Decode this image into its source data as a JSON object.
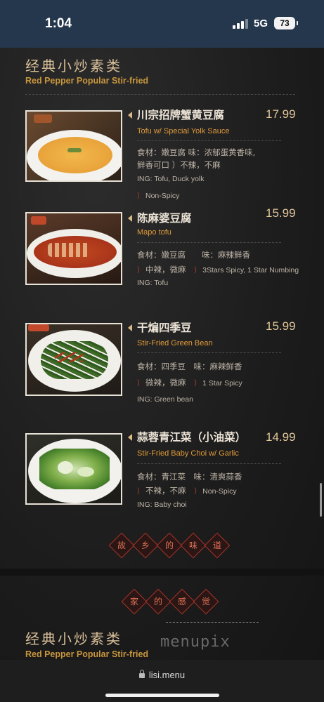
{
  "status_bar": {
    "time": "1:04",
    "network": "5G",
    "battery": "73"
  },
  "menu": {
    "section_title_zh": "经典小炒素类",
    "section_title_en": "Red Pepper Popular Stir-fried",
    "items": [
      {
        "name_zh": "川宗招牌蟹黄豆腐",
        "price": "17.99",
        "name_en": "Tofu w/ Special Yolk Sauce",
        "lines": [
          "食材：嫩豆腐 味：浓郁蛋黄香味,",
          "鲜香可口 ）不辣，不麻",
          "ING: Tofu, Duck yolk",
          "Non-Spicy"
        ],
        "photo": "tofu-yolk-soup-photo"
      },
      {
        "name_zh": "陈麻婆豆腐",
        "price": "15.99",
        "name_en": "Mapo tofu",
        "lines": [
          "食材：嫩豆腐　　味：麻辣鲜香",
          "中辣，微麻",
          "3Stars Spicy, 1 Star Numbing",
          "ING: Tofu"
        ],
        "photo": "mapo-tofu-photo"
      },
      {
        "name_zh": "干煸四季豆",
        "price": "15.99",
        "name_en": "Stir-Fried Green Bean",
        "lines": [
          "食材：四季豆　味：麻辣鲜香",
          "微辣，微麻",
          "1 Star Spicy",
          "ING: Green bean"
        ],
        "photo": "green-bean-photo"
      },
      {
        "name_zh": "蒜蓉青江菜（小油菜）",
        "price": "14.99",
        "name_en": "Stir-Fried Baby Choi w/ Garlic",
        "lines": [
          "食材：青江菜　味：清爽蒜香",
          "不辣，不麻",
          "Non-Spicy",
          "ING: Baby choi"
        ],
        "photo": "baby-choi-photo"
      }
    ],
    "seal_1": [
      "故",
      "乡",
      "的",
      "味",
      "道"
    ],
    "seal_2": [
      "家",
      "的",
      "感",
      "觉"
    ],
    "section2_title_zh": "经典小炒素类",
    "section2_title_en": "Red Pepper Popular Stir-fried",
    "watermark": "menupix"
  },
  "browser": {
    "url": "lisi.menu"
  },
  "colors": {
    "status_bar_bg": "#25374c",
    "menu_bg": "#1c1c1c",
    "gold": "#c8963e",
    "accent_orange": "#e09a3a",
    "spice_red": "#c9402c"
  }
}
